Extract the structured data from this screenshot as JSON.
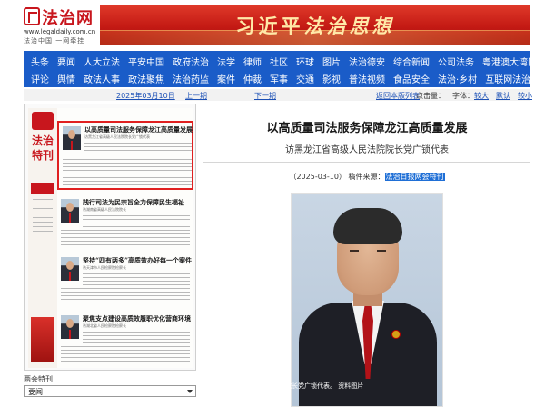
{
  "header": {
    "logo_cn": "法治网",
    "logo_en": "www.legaldaily.com.cn",
    "logo_slogan": "法治中国 一网牵挂",
    "banner_text_a": "习近平",
    "banner_text_b": "法治思想"
  },
  "nav": {
    "row1": [
      "头条",
      "要闻",
      "人大立法",
      "平安中国",
      "政府法治",
      "法学",
      "律师",
      "社区",
      "环球",
      "图片",
      "法治德安",
      "综合新闻",
      "公司法务",
      "粤港澳大湾区"
    ],
    "row2": [
      "评论",
      "舆情",
      "政法人事",
      "政法聚焦",
      "法治药监",
      "案件",
      "仲裁",
      "军事",
      "交通",
      "影视",
      "普法视频",
      "食品安全",
      "法治·乡村",
      "互联网法治"
    ]
  },
  "infobar": {
    "date": "2025年03月10日",
    "prev": "上一期",
    "next": "下一期",
    "pdf": "返回本版列表",
    "clicks_label": "点击量：",
    "font_label": "字体：",
    "font_large": "较大",
    "font_default": "默认",
    "font_small": "较小"
  },
  "paper": {
    "masthead": "法治特刊",
    "stories": [
      {
        "title": "以高质量司法服务保障龙江高质量发展",
        "sub": "访黑龙江省高级人民法院院长党广锁代表"
      },
      {
        "title": "践行司法为民宗旨全力保障民生福祉",
        "sub": "访湖南省高级人民法院院长"
      },
      {
        "title": "坚持“四有两多”高质效办好每一个案件",
        "sub": "访天津市人民检察院检察长"
      },
      {
        "title": "聚焦支点建设高质效履职优化营商环境",
        "sub": "访湖北省人民检察院检察长"
      }
    ]
  },
  "section": {
    "label": "两会特刊",
    "select_value": "要闻"
  },
  "article": {
    "title": "以高质量司法服务保障龙江高质量发展",
    "subtitle": "访黑龙江省高级人民法院院长党广锁代表",
    "date": "（2025-03-10）",
    "source_label": "稿件来源：",
    "source": "法治日报两会特刊",
    "caption": "图为黑龙江省高级人民法院院长党广锁代表。 资料图片"
  },
  "colors": {
    "brand_red": "#c8161d",
    "nav_blue": "#1a5cc8",
    "highlight_blue": "#1f6fd6"
  }
}
